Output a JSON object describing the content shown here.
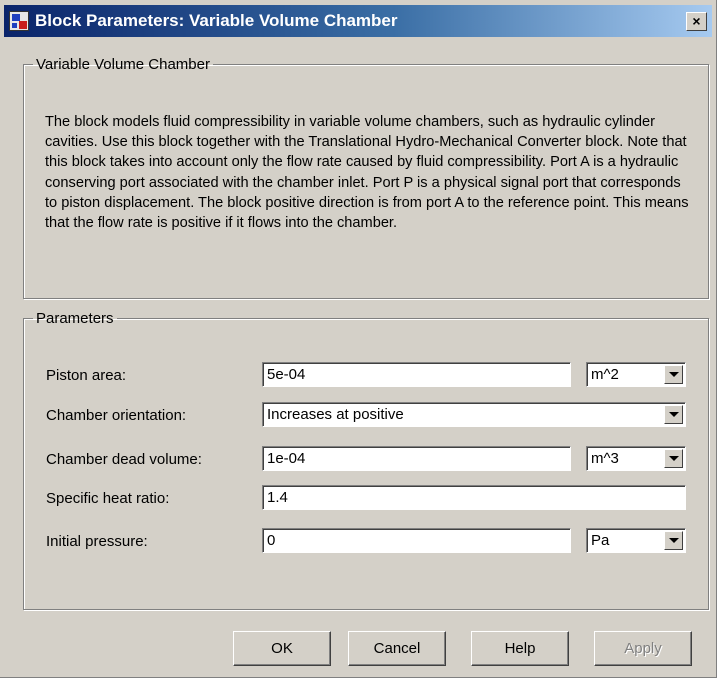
{
  "window": {
    "title": "Block Parameters: Variable Volume Chamber",
    "close_label": "×"
  },
  "description": {
    "legend": "Variable Volume Chamber",
    "text": "The block models fluid compressibility in variable volume chambers, such as hydraulic cylinder cavities. Use this block together with the Translational Hydro-Mechanical Converter block. Note that this block takes into account only the flow rate caused by fluid compressibility. Port A is a hydraulic conserving port associated with the chamber inlet. Port P is a physical signal port that corresponds to piston displacement. The block positive direction is from port A to the reference point. This means that the flow rate is positive if it flows into the chamber."
  },
  "parameters": {
    "legend": "Parameters",
    "piston_area": {
      "label": "Piston area:",
      "value": "5e-04",
      "unit": "m^2"
    },
    "chamber_orientation": {
      "label": "Chamber orientation:",
      "value": "Increases at positive"
    },
    "chamber_dead_volume": {
      "label": "Chamber dead volume:",
      "value": "1e-04",
      "unit": "m^3"
    },
    "specific_heat_ratio": {
      "label": "Specific heat ratio:",
      "value": "1.4"
    },
    "initial_pressure": {
      "label": "Initial pressure:",
      "value": "0",
      "unit": "Pa"
    }
  },
  "buttons": {
    "ok": "OK",
    "cancel": "Cancel",
    "help": "Help",
    "apply": "Apply"
  },
  "icons": {
    "app_icon": "simulink-block-icon",
    "combo_arrow": "chevron-down-icon"
  }
}
